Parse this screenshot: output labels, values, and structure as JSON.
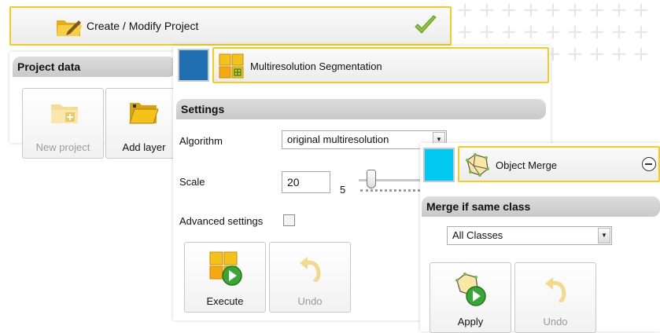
{
  "create_bar": {
    "title": "Create / Modify Project",
    "icon": "folder-pen-icon",
    "status_icon": "checkmark-icon",
    "status_color": "#8cc63f"
  },
  "project_panel": {
    "header": "Project data",
    "buttons": [
      {
        "label": "New project",
        "icon": "new-folder-icon",
        "enabled": false
      },
      {
        "label": "Add layer",
        "icon": "open-folder-icon",
        "enabled": true
      }
    ]
  },
  "segmentation": {
    "title": "Multiresolution Segmentation",
    "swatch_color": "#1f6fb2",
    "settings_header": "Settings",
    "algorithm_label": "Algorithm",
    "algorithm_value": "original multiresolution",
    "scale_label": "Scale",
    "scale_value": "20",
    "scale_min": "5",
    "advanced_label": "Advanced settings",
    "execute_label": "Execute",
    "undo_label": "Undo"
  },
  "merge": {
    "title": "Object Merge",
    "swatch_color": "#00c8f0",
    "header": "Merge if same class",
    "class_value": "All Classes",
    "apply_label": "Apply",
    "undo_label": "Undo",
    "collapse_icon": "minus-circle-icon"
  },
  "accent_color": "#f4cc1e"
}
